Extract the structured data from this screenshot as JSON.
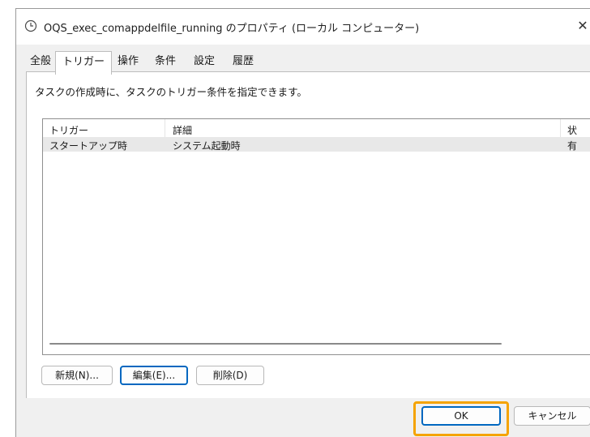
{
  "window": {
    "title": "OQS_exec_comappdelfile_running のプロパティ (ローカル コンピューター)",
    "close_symbol": "✕"
  },
  "tabs": [
    {
      "label": "全般",
      "active": false
    },
    {
      "label": "トリガー",
      "active": true
    },
    {
      "label": "操作",
      "active": false
    },
    {
      "label": "条件",
      "active": false
    },
    {
      "label": "設定",
      "active": false
    },
    {
      "label": "履歴",
      "active": false
    }
  ],
  "trigger_tab": {
    "description": "タスクの作成時に、タスクのトリガー条件を指定できます。",
    "columns": [
      "トリガー",
      "詳細",
      "状"
    ],
    "rows": [
      {
        "trigger": "スタートアップ時",
        "detail": "システム起動時",
        "status": "有"
      }
    ],
    "buttons": {
      "new": "新規(N)...",
      "edit": "編集(E)...",
      "delete": "削除(D)"
    }
  },
  "footer": {
    "ok": "OK",
    "cancel": "キャンセル"
  },
  "colors": {
    "accent_border": "#0067c0",
    "highlight": "#f5a300",
    "selected_row": "#e8e8e8"
  }
}
